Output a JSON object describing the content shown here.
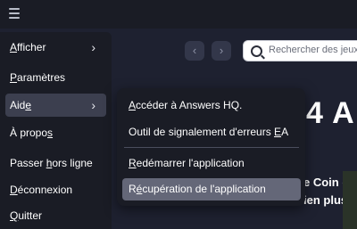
{
  "colors": {
    "menu_bg": "#1a1c25",
    "app_bg": "#1e2130",
    "active_item": "#3c3f4f",
    "hovered_subitem": "#646778",
    "text": "#ffffff"
  },
  "topbar": {
    "menu_icon": "hamburger-icon"
  },
  "background": {
    "back_icon": "‹",
    "forward_icon": "›",
    "search_placeholder": "Rechercher des jeux",
    "hero_title": "4 A",
    "hero_line_1": "e Coin de",
    "hero_line_2": "ien plus e"
  },
  "main_menu": {
    "items": [
      {
        "pre": "",
        "u": "A",
        "post": "fficher",
        "has_submenu": true,
        "chevron": "›"
      },
      {
        "pre": "",
        "u": "P",
        "post": "aramètres",
        "has_submenu": false
      },
      {
        "pre": "Aid",
        "u": "e",
        "post": "",
        "has_submenu": true,
        "chevron": "›"
      },
      {
        "pre": "À propo",
        "u": "s",
        "post": "",
        "has_submenu": false
      },
      {
        "pre": "Passer ",
        "u": "h",
        "post": "ors ligne",
        "has_submenu": false
      },
      {
        "pre": "",
        "u": "D",
        "post": "éconnexion",
        "has_submenu": false
      },
      {
        "pre": "",
        "u": "Q",
        "post": "uitter",
        "has_submenu": false
      }
    ]
  },
  "help_submenu": {
    "items": [
      {
        "pre": "",
        "u": "A",
        "post": "ccéder à Answers HQ."
      },
      {
        "pre": "Outil de signalement d'erreurs ",
        "u": "E",
        "post": "A"
      },
      {
        "pre": "",
        "u": "R",
        "post": "edémarrer l'application"
      },
      {
        "pre": "R",
        "u": "é",
        "post": "cupération de l'application"
      }
    ]
  }
}
